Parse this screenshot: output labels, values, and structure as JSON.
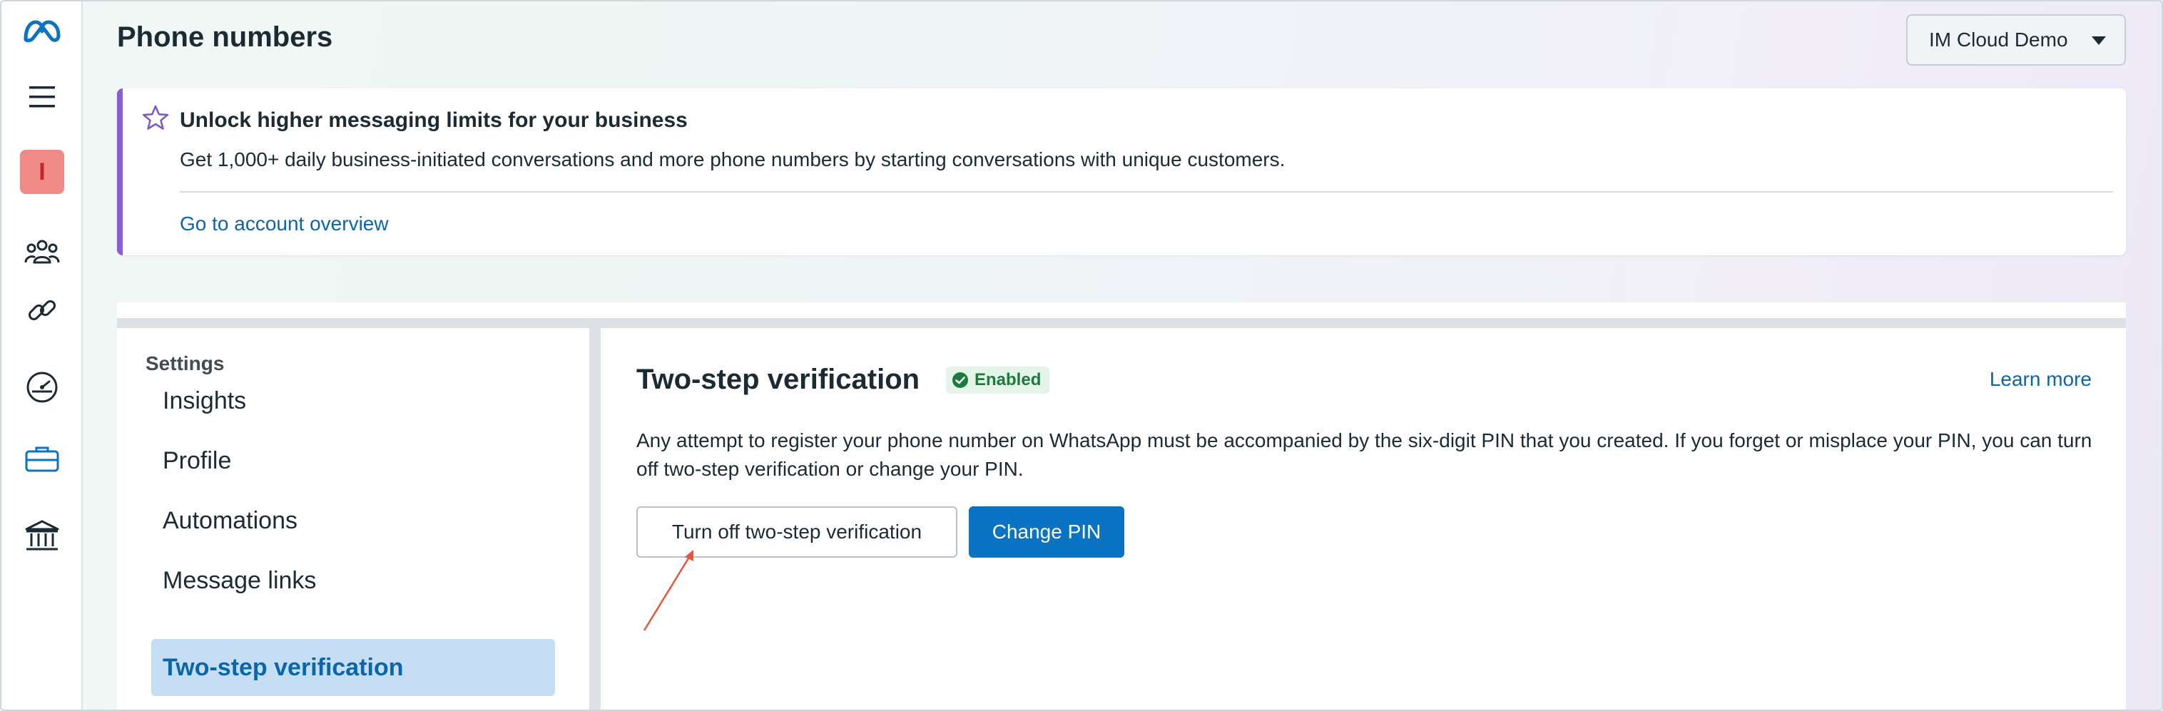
{
  "header": {
    "title": "Phone numbers",
    "account_select": "IM Cloud Demo"
  },
  "sidebar": {
    "icons": [
      "meta-logo-icon",
      "menu-icon",
      "avatar-tile",
      "people-icon",
      "link-icon",
      "dashboard-gauge-icon",
      "briefcase-icon",
      "bank-icon"
    ],
    "avatar_letter": "I"
  },
  "banner": {
    "title": "Unlock higher messaging limits for your business",
    "body": "Get 1,000+ daily business-initiated conversations and more phone numbers by starting conversations with unique customers.",
    "link": "Go to account overview"
  },
  "settings": {
    "heading": "Settings",
    "items": [
      {
        "label": "Insights"
      },
      {
        "label": "Profile"
      },
      {
        "label": "Automations"
      },
      {
        "label": "Message links"
      },
      {
        "label": "Two-step verification",
        "active": true
      }
    ]
  },
  "content": {
    "title": "Two-step verification",
    "badge": "Enabled",
    "learn_more": "Learn more",
    "description": "Any attempt to register your phone number on WhatsApp must be accompanied by the six-digit PIN that you created. If you forget or misplace your PIN, you can turn off two-step verification or change your PIN.",
    "turn_off_button": "Turn off two-step verification",
    "change_pin_button": "Change PIN"
  },
  "colors": {
    "accent": "#0a73c2",
    "link": "#0a66a8",
    "banner_accent": "#8a5cd6",
    "enabled_badge": "#1d7a3d",
    "annotation_arrow": "#e8543c"
  }
}
